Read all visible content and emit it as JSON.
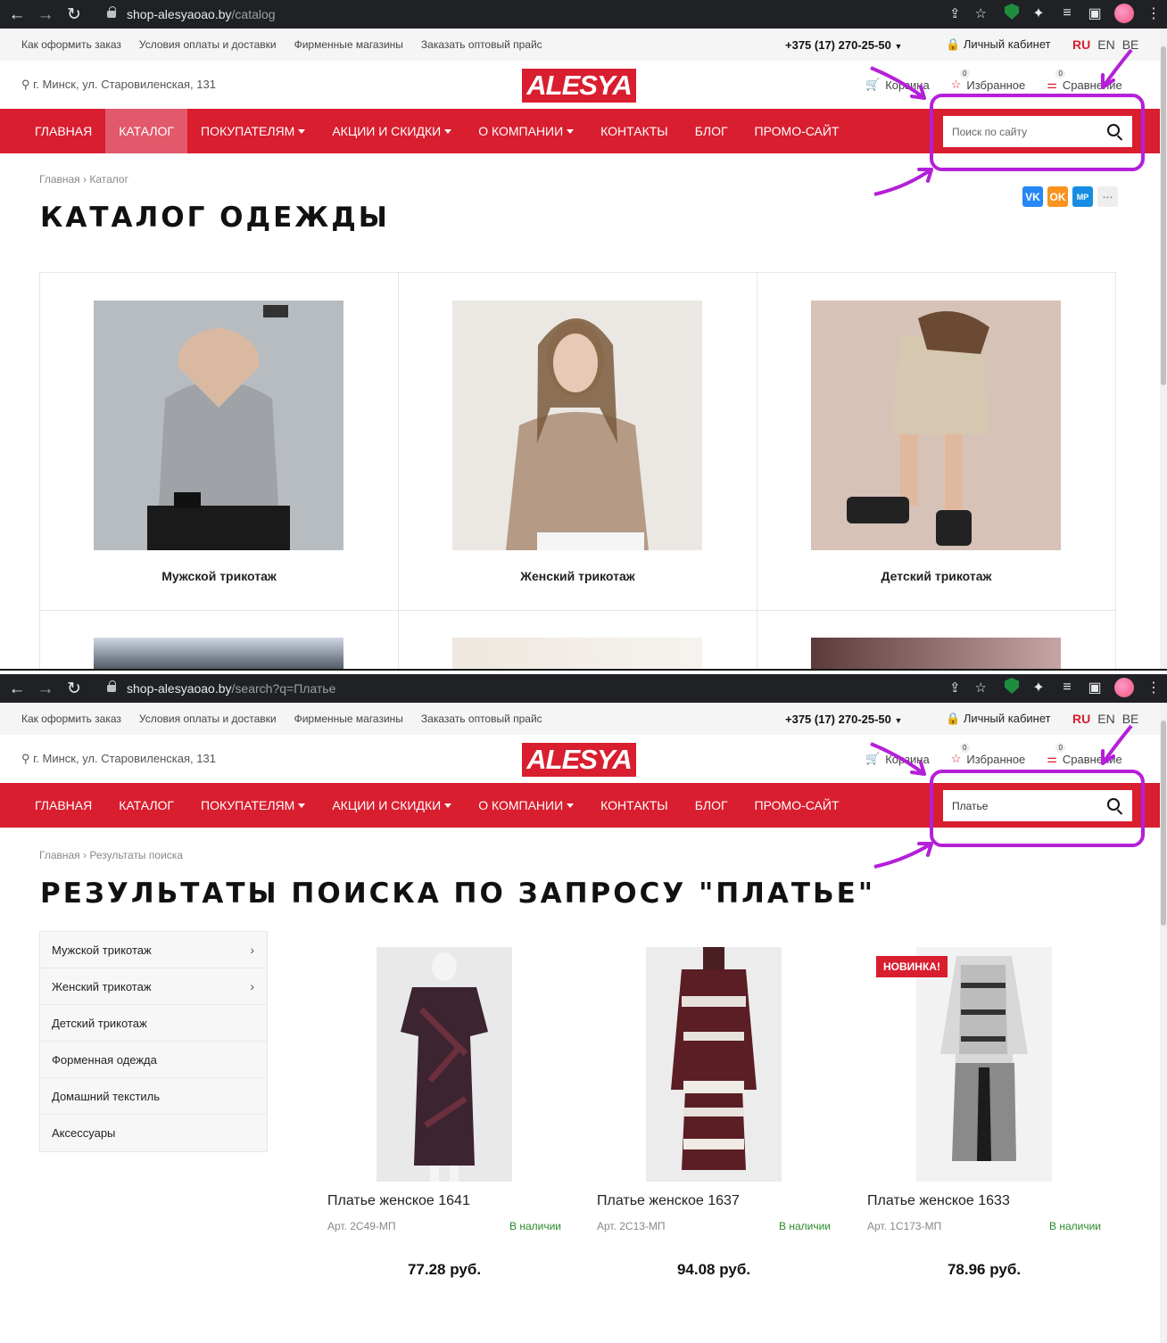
{
  "browser": {
    "url1_host": "shop-alesyaoao.by",
    "url1_path": "/catalog",
    "url2_host": "shop-alesyaoao.by",
    "url2_path": "/search?q=Платье"
  },
  "topbar": {
    "links": [
      "Как оформить заказ",
      "Условия оплаты и доставки",
      "Фирменные магазины",
      "Заказать оптовый прайс"
    ],
    "phone": "+375 (17) 270-25-50",
    "cabinet": "Личный кабинет",
    "langs": [
      "RU",
      "EN",
      "BE"
    ]
  },
  "header": {
    "address": "г. Минск, ул. Старовиленская, 131",
    "logo": "ALESYA",
    "cart": "Корзина",
    "favorites": "Избранное",
    "favorites_count": "0",
    "compare": "Сравнение",
    "compare_count": "0"
  },
  "menu": {
    "items": [
      "Главная",
      "Каталог",
      "Покупателям",
      "Акции и скидки",
      "О компании",
      "Контакты",
      "Блог",
      "Промо-сайт"
    ],
    "search_placeholder": "Поиск по сайту",
    "search_value": "Платье"
  },
  "page1": {
    "crumb_home": "Главная",
    "crumb_current": "Каталог",
    "title": "Каталог одежды",
    "categories": [
      "Мужской трикотаж",
      "Женский трикотаж",
      "Детский трикотаж"
    ]
  },
  "page2": {
    "crumb_home": "Главная",
    "crumb_current": "Результаты поиска",
    "title": "Результаты поиска по запросу \"Платье\"",
    "sidebar": [
      "Мужской трикотаж",
      "Женский трикотаж",
      "Детский трикотаж",
      "Форменная одежда",
      "Домашний текстиль",
      "Аксессуары"
    ],
    "badge": "НОВИНКА!",
    "products": [
      {
        "name": "Платье женское 1641",
        "art": "Арт. 2С49-МП",
        "stock": "В наличии",
        "price": "77.28 руб."
      },
      {
        "name": "Платье женское 1637",
        "art": "Арт. 2С13-МП",
        "stock": "В наличии",
        "price": "94.08 руб."
      },
      {
        "name": "Платье женское 1633",
        "art": "Арт. 1С173-МП",
        "stock": "В наличии",
        "price": "78.96 руб."
      }
    ]
  },
  "social": [
    "VK",
    "OK",
    "МР"
  ],
  "colors": {
    "brand": "#d81e2f",
    "annotation": "#b51fd9",
    "stock": "#2a8a2a"
  },
  "icons": [
    "back-icon",
    "forward-icon",
    "reload-icon",
    "lock-icon",
    "share-icon",
    "star-icon",
    "extension-icon",
    "search-icon",
    "cart-icon",
    "map-pin-icon"
  ]
}
